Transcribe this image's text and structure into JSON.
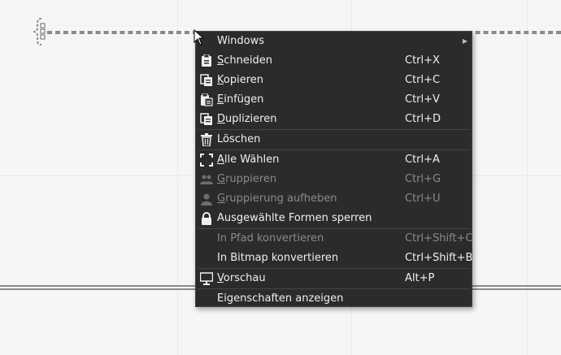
{
  "menu": {
    "windows": {
      "label": "Windows",
      "has_submenu": true
    },
    "cut": {
      "label_accel": "S",
      "label_rest": "chneiden",
      "shortcut": "Ctrl+X"
    },
    "copy": {
      "label_accel": "K",
      "label_rest": "opieren",
      "shortcut": "Ctrl+C"
    },
    "paste": {
      "label_accel": "E",
      "label_rest": "infügen",
      "shortcut": "Ctrl+V"
    },
    "duplicate": {
      "label_accel": "D",
      "label_rest": "uplizieren",
      "shortcut": "Ctrl+D"
    },
    "delete": {
      "label": "Löschen"
    },
    "select_all": {
      "label_accel": "A",
      "label_rest": "lle Wählen",
      "shortcut": "Ctrl+A"
    },
    "group": {
      "label_accel": "G",
      "label_rest": "ruppieren",
      "shortcut": "Ctrl+G",
      "disabled": true
    },
    "ungroup": {
      "label_accel": "G",
      "label_rest": "ruppierung aufheben",
      "shortcut": "Ctrl+U",
      "disabled": true
    },
    "lock_shapes": {
      "label": "Ausgewählte Formen sperren"
    },
    "to_path": {
      "label": "In Pfad konvertieren",
      "shortcut": "Ctrl+Shift+C",
      "disabled": true
    },
    "to_bitmap": {
      "label": "In Bitmap konvertieren",
      "shortcut": "Ctrl+Shift+B"
    },
    "preview": {
      "label_accel": "V",
      "label_rest": "orschau",
      "shortcut": "Alt+P"
    },
    "properties": {
      "label": "Eigenschaften anzeigen"
    }
  },
  "colors": {
    "menu_bg": "#2b2b2b",
    "menu_text": "#efefef",
    "menu_text_disabled": "#8a8a8a",
    "canvas_bg": "#f6f6f6"
  }
}
